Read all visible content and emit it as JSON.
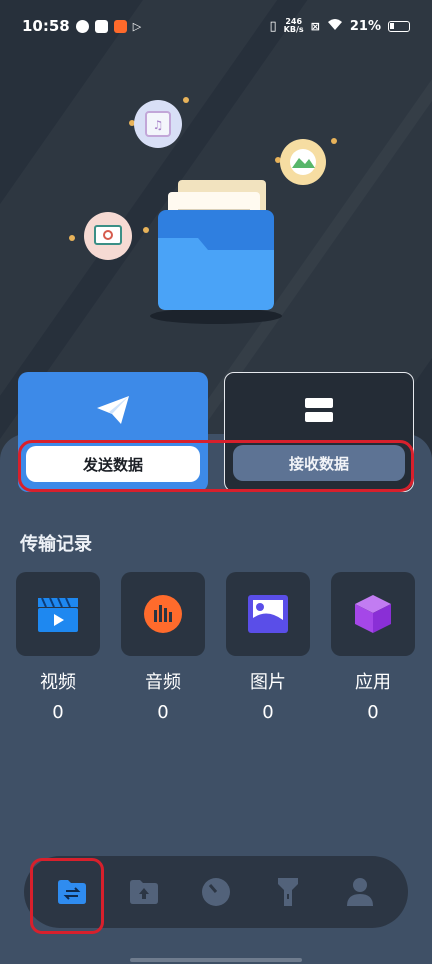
{
  "status_bar": {
    "time": "10:58",
    "net_speed_top": "246",
    "net_speed_bottom": "KB/s",
    "battery": "21%"
  },
  "actions": {
    "send_label": "发送数据",
    "receive_label": "接收数据"
  },
  "history": {
    "title": "传输记录",
    "items": [
      {
        "label": "视频",
        "count": "0",
        "icon": "video-icon"
      },
      {
        "label": "音频",
        "count": "0",
        "icon": "audio-icon"
      },
      {
        "label": "图片",
        "count": "0",
        "icon": "image-icon"
      },
      {
        "label": "应用",
        "count": "0",
        "icon": "app-cube-icon"
      }
    ]
  },
  "bottom_nav": {
    "items": [
      {
        "name": "transfer",
        "icon": "folder-transfer-icon",
        "active": true
      },
      {
        "name": "files",
        "icon": "folder-upload-icon",
        "active": false
      },
      {
        "name": "clean",
        "icon": "gauge-icon",
        "active": false
      },
      {
        "name": "flashlight",
        "icon": "flashlight-icon",
        "active": false
      },
      {
        "name": "profile",
        "icon": "person-icon",
        "active": false
      }
    ]
  },
  "colors": {
    "accent": "#3d8ae8",
    "highlight_outline": "#d8202c",
    "panel": "#3f5066"
  }
}
